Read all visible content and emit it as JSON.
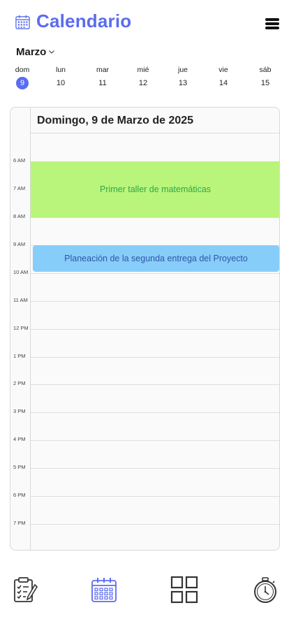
{
  "header": {
    "title": "Calendario",
    "icon": "calendar-icon",
    "menu_icon": "hamburger-icon"
  },
  "month_selector": {
    "label": "Marzo",
    "icon": "chevron-down-icon"
  },
  "week": {
    "days": [
      {
        "name": "dom",
        "number": "9",
        "selected": true
      },
      {
        "name": "lun",
        "number": "10",
        "selected": false
      },
      {
        "name": "mar",
        "number": "11",
        "selected": false
      },
      {
        "name": "mié",
        "number": "12",
        "selected": false
      },
      {
        "name": "jue",
        "number": "13",
        "selected": false
      },
      {
        "name": "vie",
        "number": "14",
        "selected": false
      },
      {
        "name": "sáb",
        "number": "15",
        "selected": false
      }
    ]
  },
  "day_view": {
    "date_title": "Domingo, 9 de Marzo de 2025",
    "hours": [
      "6 AM",
      "7 AM",
      "8 AM",
      "9 AM",
      "10 AM",
      "11 AM",
      "12 PM",
      "1 PM",
      "2 PM",
      "3 PM",
      "4 PM",
      "5 PM",
      "6 PM",
      "7 PM"
    ],
    "events": [
      {
        "title": "Primer taller de matemáticas",
        "color": "#b9f57a",
        "text_color": "#2ea84a"
      },
      {
        "title": "Planeación de la segunda entrega del Proyecto",
        "color": "#87cdfa",
        "text_color": "#2f56a6"
      }
    ]
  },
  "bottom_nav": {
    "items": [
      {
        "icon": "clipboard-checklist-icon"
      },
      {
        "icon": "calendar-icon",
        "active": true,
        "active_color": "#5a6cf0"
      },
      {
        "icon": "grid-icon"
      },
      {
        "icon": "stopwatch-icon"
      }
    ]
  },
  "colors": {
    "accent": "#5a6cf0"
  }
}
